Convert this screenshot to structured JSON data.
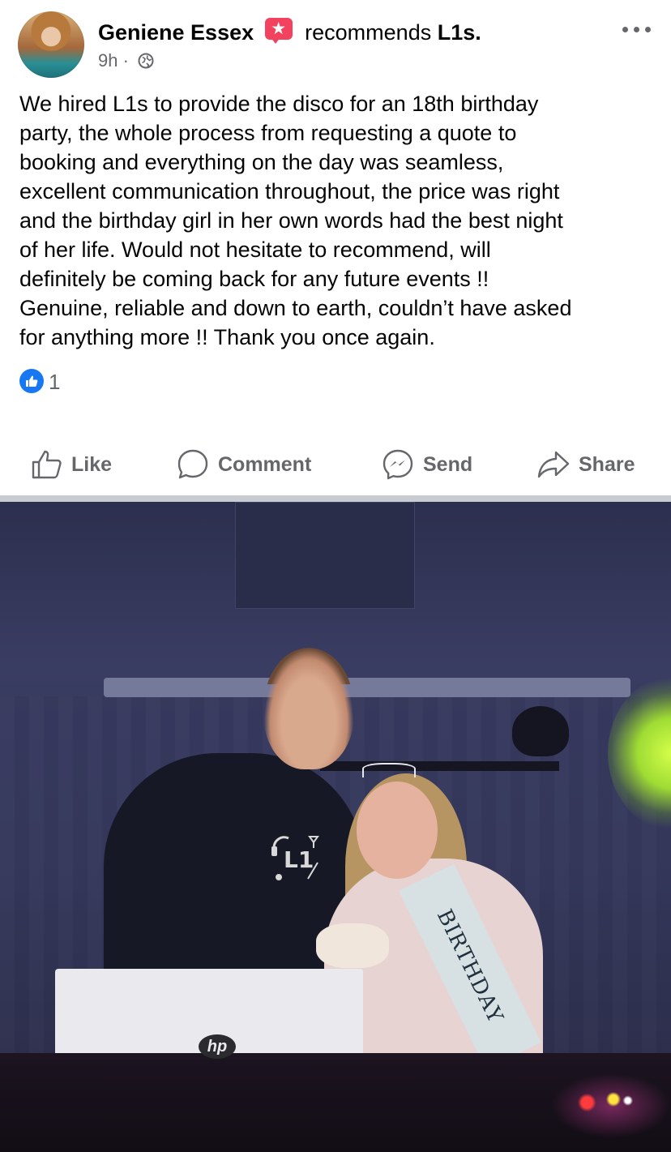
{
  "post": {
    "author_name": "Geniene Essex",
    "action_text": "recommends",
    "page_name": "L1s.",
    "time": "9h",
    "separator": "·",
    "privacy_icon": "globe-icon",
    "body": "We hired L1s to provide the disco for an 18th birthday\nparty, the whole process from requesting a quote to\nbooking and everything on the day was seamless,\nexcellent communication throughout, the price was right\nand the birthday girl in her own words had the best night\nof her life. Would not hesitate to recommend, will\ndefinitely be coming back for any future events !!\nGenuine, reliable and down to earth, couldn’t have asked\nfor anything more !! Thank you once again.",
    "reaction_count": "1",
    "reaction_icon": "like-reaction-icon"
  },
  "actions": {
    "like": "Like",
    "comment": "Comment",
    "send": "Send",
    "share": "Share"
  },
  "photo": {
    "sash_text": "BIRTHDAY",
    "laptop_brand": "hp"
  },
  "colors": {
    "text": "#050505",
    "secondary": "#65676b",
    "facebook_blue": "#1877f2",
    "recommend_badge": "#f3425f",
    "divider": "#c9ccd1"
  }
}
